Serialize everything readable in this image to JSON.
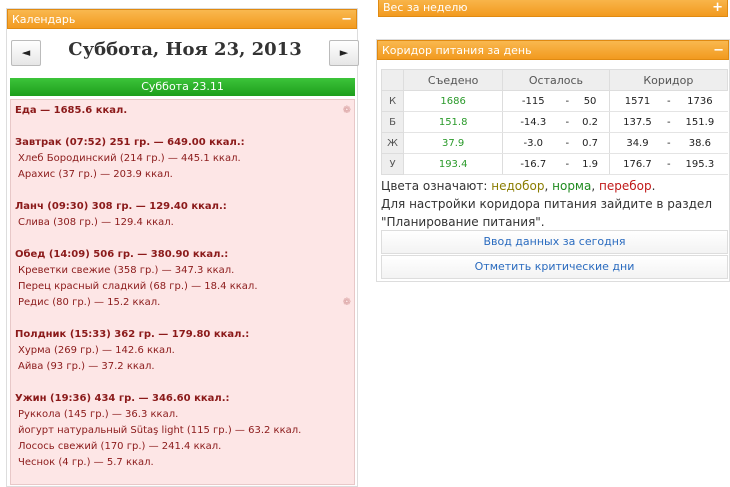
{
  "calendar": {
    "title": "Календарь",
    "collapse_symbol": "−",
    "prev_label": "◄",
    "next_label": "►",
    "date": "Суббота, Ноя 23, 2013",
    "day_bar": "Суббота 23.11"
  },
  "meals": {
    "total": "Еда — 1685.6 ккал.",
    "pin": "❁",
    "groups": [
      {
        "title": "Завтрак (07:52) 251 гр. — 649.00 ккал.:",
        "items": [
          "Хлеб Бородинский (214 гр.) — 445.1 ккал.",
          "Арахис (37 гр.) — 203.9 ккал."
        ]
      },
      {
        "title": "Ланч (09:30) 308 гр. — 129.40 ккал.:",
        "items": [
          "Слива (308 гр.) — 129.4 ккал."
        ]
      },
      {
        "title": "Обед (14:09) 506 гр. — 380.90 ккал.:",
        "items": [
          "Креветки свежие (358 гр.) — 347.3 ккал.",
          "Перец красный сладкий (68 гр.) — 18.4 ккал.",
          "Редис (80 гр.) — 15.2 ккал."
        ]
      },
      {
        "title": "Полдник (15:33) 362 гр. — 179.80 ккал.:",
        "items": [
          "Хурма (269 гр.) — 142.6 ккал.",
          "Айва (93 гр.) — 37.2 ккал."
        ]
      },
      {
        "title": "Ужин (19:36) 434 гр. — 346.60 ккал.:",
        "items": [
          "Руккола (145 гр.) — 36.3 ккал.",
          "йогурт натуральный Sütaş light (115 гр.) — 63.2 ккал.",
          "Лосось свежий (170 гр.) — 241.4 ккал.",
          "Чеснок (4 гр.) — 5.7 ккал."
        ]
      }
    ]
  },
  "week": {
    "title": "Вес за неделю",
    "expand_symbol": "+"
  },
  "corridor": {
    "title": "Коридор питания за день",
    "collapse_symbol": "−",
    "headers": [
      "",
      "Съедено",
      "Осталось",
      "Коридор"
    ],
    "rows": [
      {
        "label": "К",
        "eaten": "1686",
        "left_min": "-115",
        "left_max": "50",
        "corr_min": "1571",
        "corr_max": "1736"
      },
      {
        "label": "Б",
        "eaten": "151.8",
        "left_min": "-14.3",
        "left_max": "0.2",
        "corr_min": "137.5",
        "corr_max": "151.9"
      },
      {
        "label": "Ж",
        "eaten": "37.9",
        "left_min": "-3.0",
        "left_max": "0.7",
        "corr_min": "34.9",
        "corr_max": "38.6"
      },
      {
        "label": "У",
        "eaten": "193.4",
        "left_min": "-16.7",
        "left_max": "1.9",
        "corr_min": "176.7",
        "corr_max": "195.3"
      }
    ],
    "dash": "-",
    "legend_prefix": "Цвета означают: ",
    "legend_under": "недобор",
    "legend_comma1": ", ",
    "legend_norm": "норма",
    "legend_comma2": ", ",
    "legend_over": "перебор",
    "legend_dot": ".",
    "note": "Для настройки коридора питания зайдите в раздел \"Планирование питания\".",
    "btn_today": "Ввод данных за сегодня",
    "btn_critical": "Отметить критические дни",
    "colors": {
      "under": "#8a7c00",
      "norm": "#1e8a1e",
      "over": "#c01818",
      "header": "#f6a532",
      "day_bar": "#2bb129"
    }
  }
}
